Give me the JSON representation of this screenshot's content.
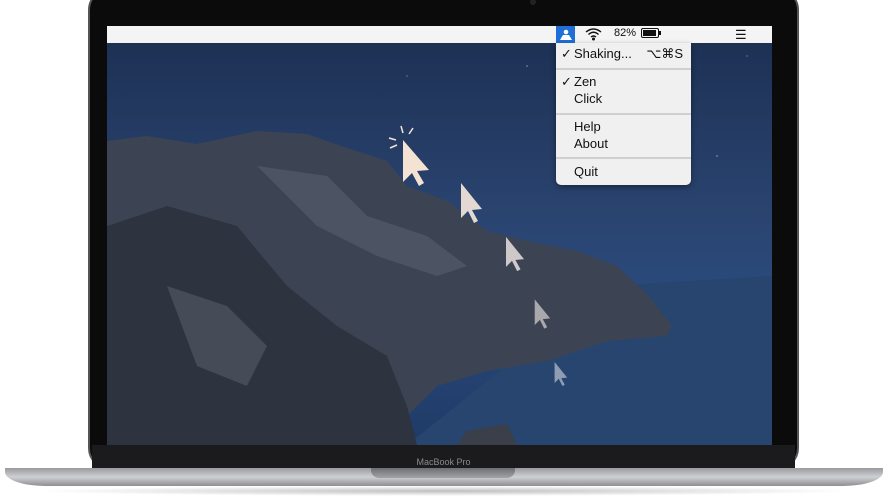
{
  "device_label": "MacBook Pro",
  "menubar": {
    "battery": "82%",
    "app_icon": "shaking-person-icon",
    "wifi_icon": "wifi-icon",
    "list_icon": "list-icon"
  },
  "menu": {
    "items": [
      {
        "label": "Shaking...",
        "checked": true,
        "shortcut": "⌥⌘S"
      },
      {
        "label": "Zen",
        "checked": true
      },
      {
        "label": "Click",
        "checked": false
      },
      {
        "label": "Help",
        "checked": false
      },
      {
        "label": "About",
        "checked": false
      },
      {
        "label": "Quit",
        "checked": false
      }
    ],
    "check_glyph": "✓"
  },
  "colors": {
    "accent": "#1f6fd6",
    "menu_bg": "#f0f0f0"
  }
}
